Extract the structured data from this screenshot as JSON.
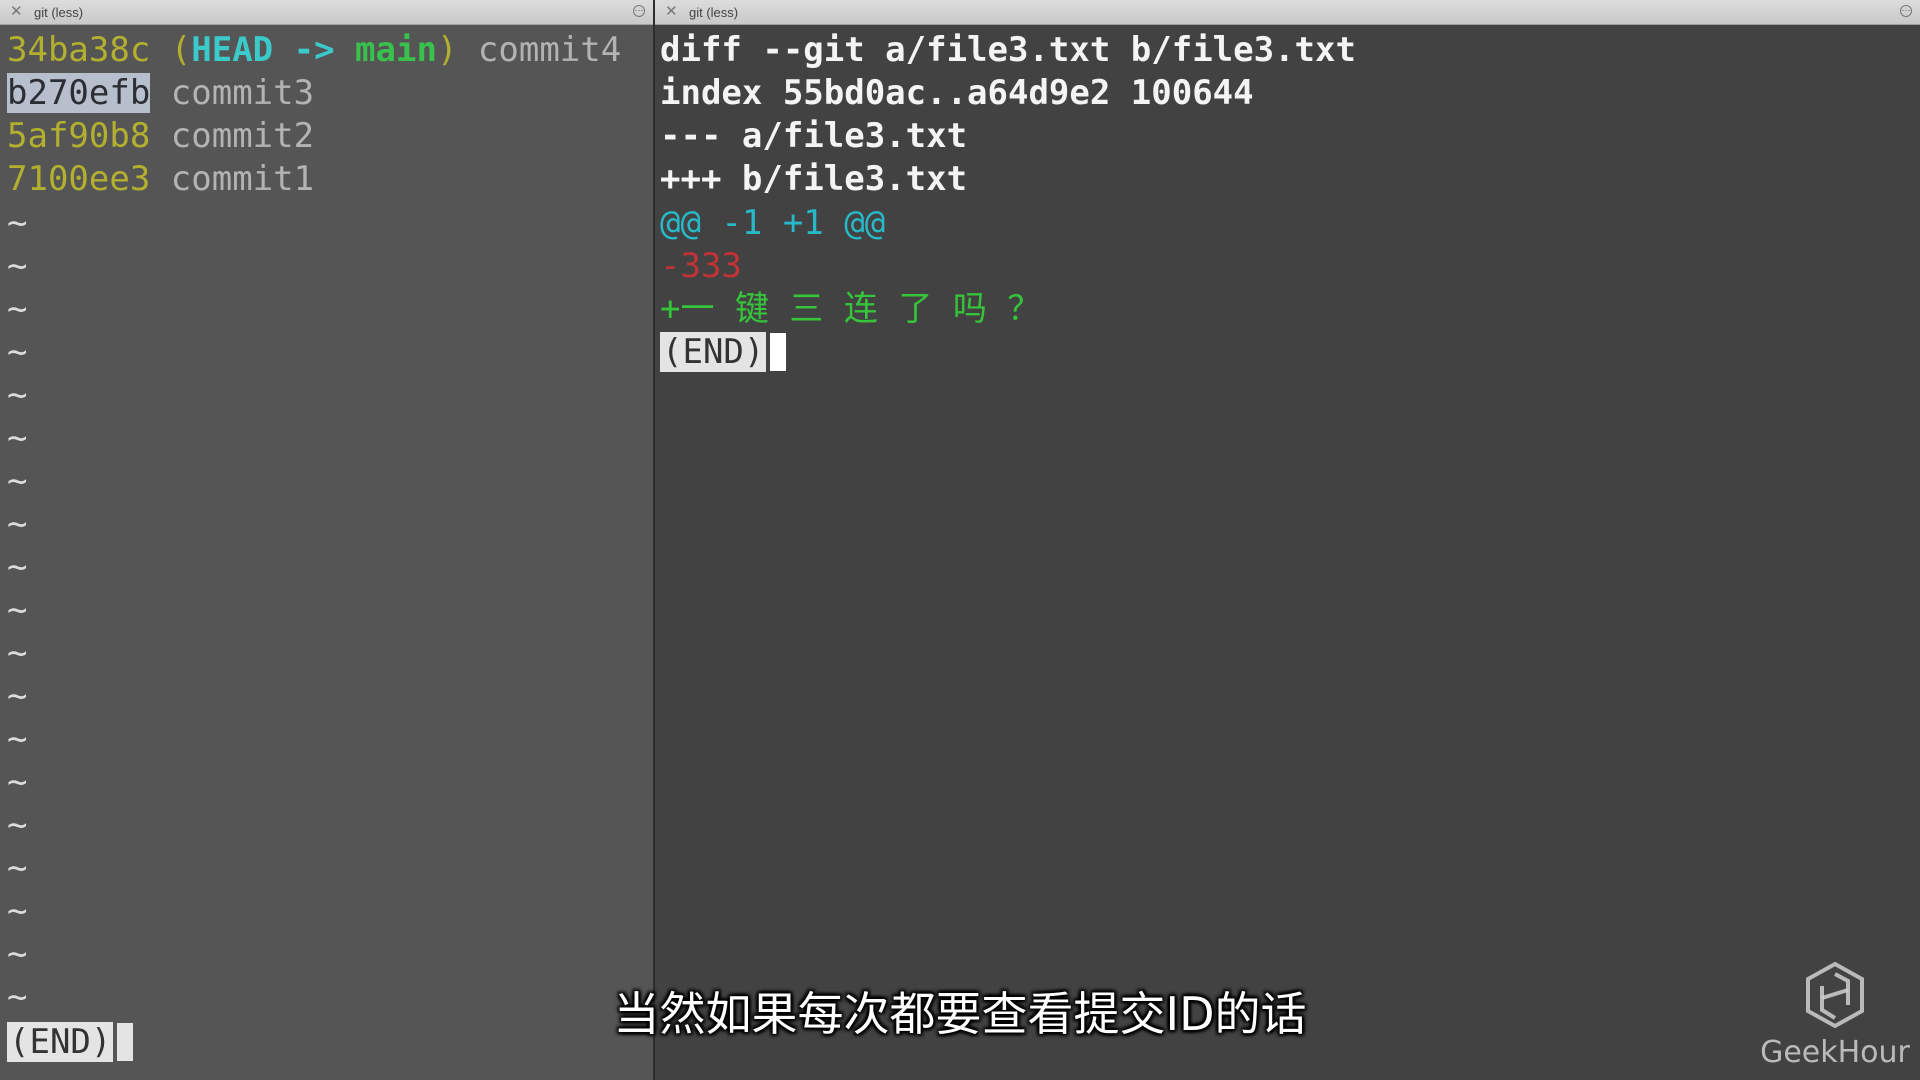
{
  "left_pane": {
    "tab_title": "git (less)",
    "log": [
      {
        "hash": "34ba38c",
        "open": "(",
        "head": "HEAD",
        "arrow": " -> ",
        "branch": "main",
        "close": ")",
        "message": "commit4"
      },
      {
        "hash": "b270efb",
        "message": "commit3",
        "selected": true
      },
      {
        "hash": "5af90b8",
        "message": "commit2"
      },
      {
        "hash": "7100ee3",
        "message": "commit1"
      }
    ],
    "tilde": "~",
    "end_label": "(END)"
  },
  "right_pane": {
    "tab_title": "git (less)",
    "diff_header": "diff --git a/file3.txt b/file3.txt",
    "index_line": "index 55bd0ac..a64d9e2 100644",
    "old_file": "--- a/file3.txt",
    "new_file": "+++ b/file3.txt",
    "hunk": "@@ -1 +1 @@",
    "removed": "-333",
    "added": "+一 键 三 连 了 吗 ？",
    "end_label": "(END)"
  },
  "subtitle": "当然如果每次都要查看提交ID的话",
  "watermark": "GeekHour",
  "colors": {
    "hash": "#b4b02f",
    "head": "#3cc9c9",
    "branch": "#38c14c",
    "hunk": "#28b9c8",
    "removed": "#c23236",
    "added": "#35c43a"
  },
  "icons": {
    "tab_close": "close-icon",
    "tab_more": "more-options-icon",
    "watermark_logo": "geekhour-logo-icon"
  }
}
